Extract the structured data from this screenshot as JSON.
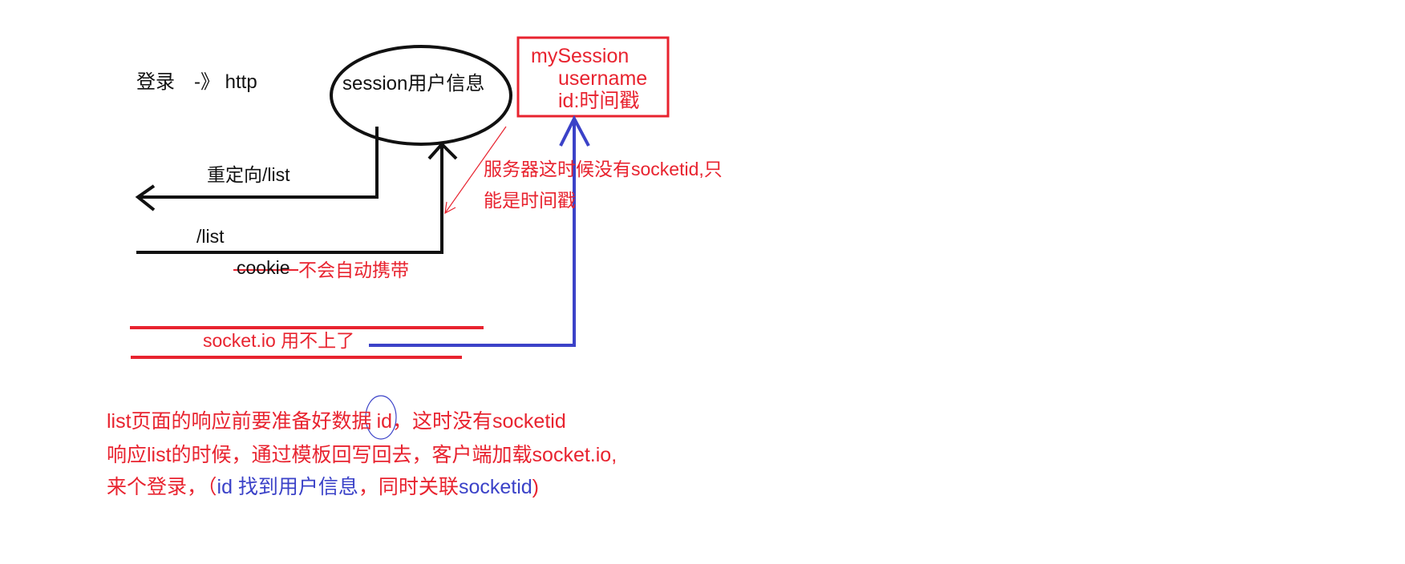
{
  "colors": {
    "black": "#111111",
    "red": "#e8232f",
    "blue": "#3b42c8"
  },
  "login": {
    "text": "登录　-》 http"
  },
  "session_node": {
    "label": "session用户信息"
  },
  "my_session_box": {
    "title": "mySession",
    "field_username": "username",
    "field_id": "id:时间戳"
  },
  "arrows": {
    "redirect_label": "重定向/list",
    "list_label": "/list"
  },
  "cookie_note": {
    "struck_text": "cookie",
    "text": "不会自动携带"
  },
  "server_note": {
    "line1": "服务器这时候没有socketid,只",
    "line2": "能是时间戳"
  },
  "socketio_note": {
    "text": "socket.io 用不上了"
  },
  "bottom_notes": {
    "line1_before": "list页面的响应前要准备好数据",
    "line1_circled": "id",
    "line1_after": "，这时没有socketid",
    "line2": "响应list的时候，通过模板回写回去，客户端加载socket.io,",
    "line3_red_start": "来个登录，（",
    "line3_blue": "id 找到用户信息",
    "line3_red_mid": "，同时关联",
    "line3_blue_end": "socketid",
    "line3_red_end": ")"
  }
}
